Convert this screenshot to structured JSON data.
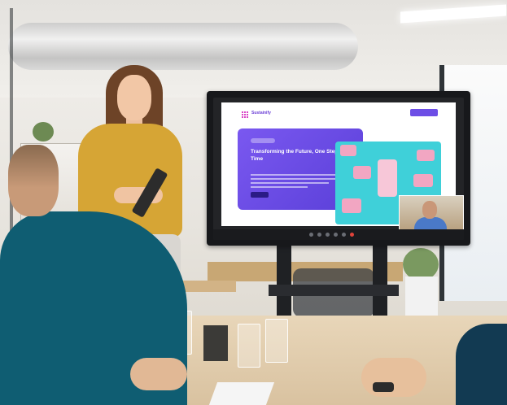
{
  "screen": {
    "brand": "Sustainify",
    "nav_links": [
      "",
      "",
      "",
      "",
      ""
    ],
    "hero_title": "Transforming the Future, One Step at a Time",
    "accent_color": "#6d4ee6",
    "hero_image_color": "#3fd0d9"
  }
}
